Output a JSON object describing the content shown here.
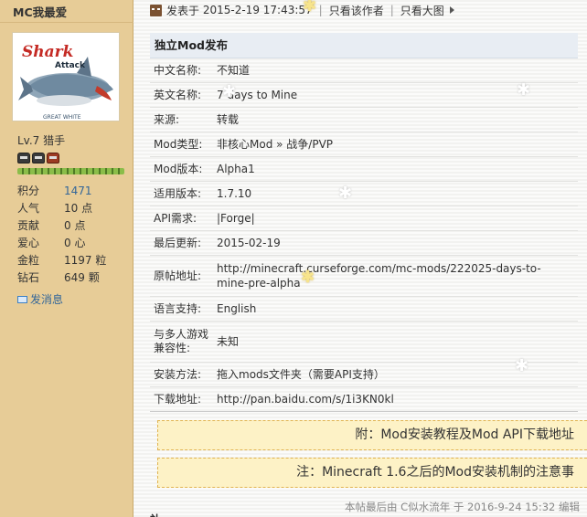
{
  "author": {
    "username": "MC我最爱",
    "level": "Lv.7 猎手",
    "stats": [
      {
        "label": "积分",
        "value": "1471",
        "link": true
      },
      {
        "label": "人气",
        "value": "10 点",
        "link": false
      },
      {
        "label": "贡献",
        "value": "0 点",
        "link": false
      },
      {
        "label": "爱心",
        "value": "0 心",
        "link": false
      },
      {
        "label": "金粒",
        "value": "1197 粒",
        "link": false
      },
      {
        "label": "钻石",
        "value": "649 颗",
        "link": false
      }
    ],
    "send_message": "发消息",
    "avatar_text": {
      "line1": "Shark",
      "line2": "Attack",
      "footer": "GREAT WHITE"
    },
    "exp_fraction": 1.0
  },
  "meta": {
    "posted_label": "发表于",
    "posted_time": "2015-2-19 17:43:57",
    "author_only": "只看该作者",
    "view_large": "只看大图"
  },
  "info": {
    "title": "独立Mod发布",
    "rows": [
      {
        "label": "中文名称:",
        "value": "不知道"
      },
      {
        "label": "英文名称:",
        "value": "7 days to Mine"
      },
      {
        "label": "来源:",
        "value": "转载"
      },
      {
        "label": "Mod类型:",
        "value": "非核心Mod » 战争/PVP"
      },
      {
        "label": "Mod版本:",
        "value": "Alpha1"
      },
      {
        "label": "适用版本:",
        "value": "1.7.10"
      },
      {
        "label": "API需求:",
        "value": "|Forge|"
      },
      {
        "label": "最后更新:",
        "value": "2015-02-19"
      },
      {
        "label": "原帖地址:",
        "value": "http://minecraft.curseforge.com/mc-mods/222025-days-to-mine-pre-alpha"
      },
      {
        "label": "语言支持:",
        "value": "English"
      },
      {
        "label": "与多人游戏兼容性:",
        "value": "未知"
      },
      {
        "label": "安装方法:",
        "value": "拖入mods文件夹（需要API支持）"
      },
      {
        "label": "下载地址:",
        "value": "http://pan.baidu.com/s/1i3KN0kl"
      }
    ]
  },
  "boxes": [
    {
      "text": "附：Mod安装教程及Mod API下载地址"
    },
    {
      "text": "注：Minecraft 1.6之后的Mod安装机制的注意事"
    }
  ],
  "edit_note": "本帖最后由 C似水流年 于 2016-9-24 15:32 编辑",
  "next_section": "补"
}
